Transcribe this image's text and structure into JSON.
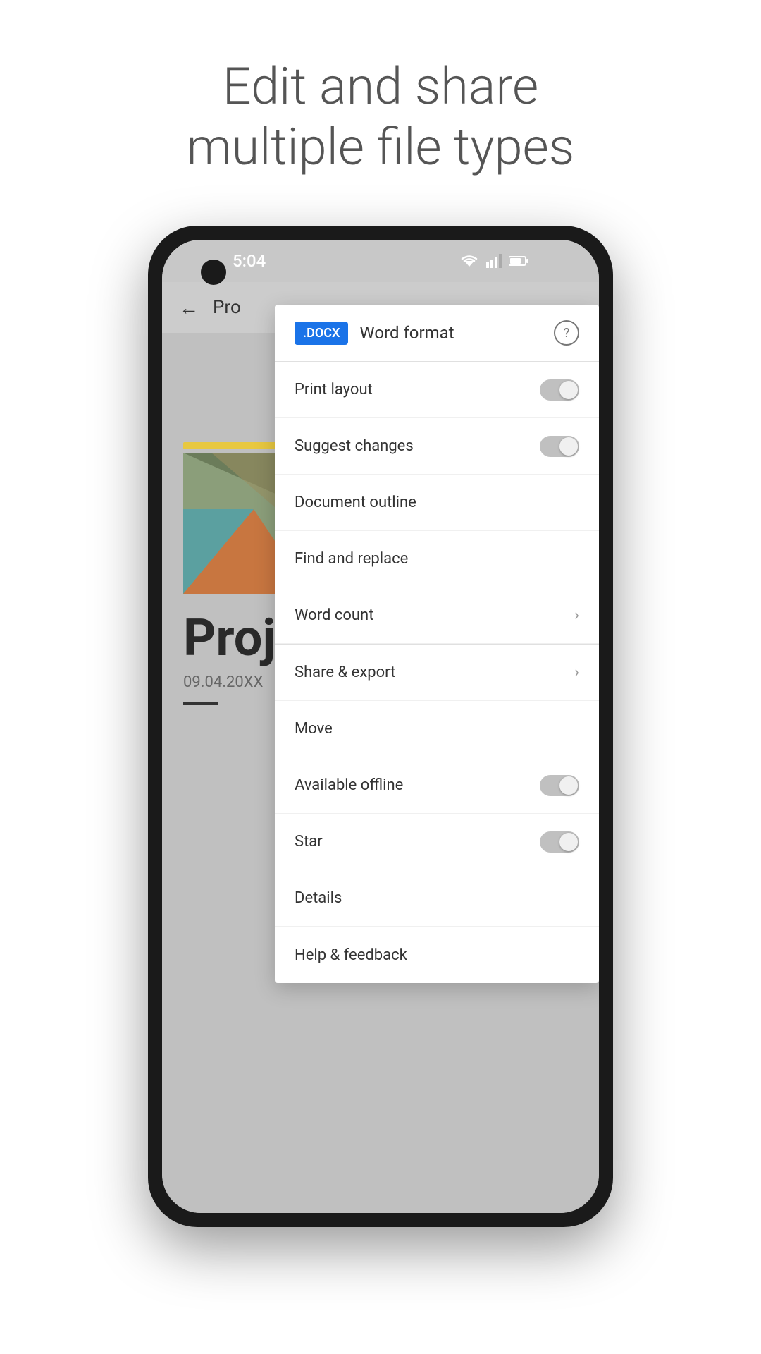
{
  "header": {
    "title_line1": "Edit and share",
    "title_line2": "multiple file types"
  },
  "status_bar": {
    "time": "5:04"
  },
  "toolbar": {
    "doc_title": "Pro"
  },
  "menu": {
    "badge": ".DOCX",
    "format_label": "Word format",
    "help_icon": "?",
    "items": [
      {
        "id": "print-layout",
        "label": "Print layout",
        "type": "toggle",
        "value": false
      },
      {
        "id": "suggest-changes",
        "label": "Suggest changes",
        "type": "toggle",
        "value": false
      },
      {
        "id": "document-outline",
        "label": "Document outline",
        "type": "none"
      },
      {
        "id": "find-replace",
        "label": "Find and replace",
        "type": "none"
      },
      {
        "id": "word-count",
        "label": "Word count",
        "type": "chevron"
      },
      {
        "id": "share-export",
        "label": "Share & export",
        "type": "chevron"
      },
      {
        "id": "move",
        "label": "Move",
        "type": "none"
      },
      {
        "id": "available-offline",
        "label": "Available offline",
        "type": "toggle",
        "value": false
      },
      {
        "id": "star",
        "label": "Star",
        "type": "toggle",
        "value": false
      },
      {
        "id": "details",
        "label": "Details",
        "type": "none"
      },
      {
        "id": "help-feedback",
        "label": "Help & feedback",
        "type": "none"
      }
    ]
  },
  "document": {
    "heading": "Proj",
    "date": "09.04.20XX"
  }
}
